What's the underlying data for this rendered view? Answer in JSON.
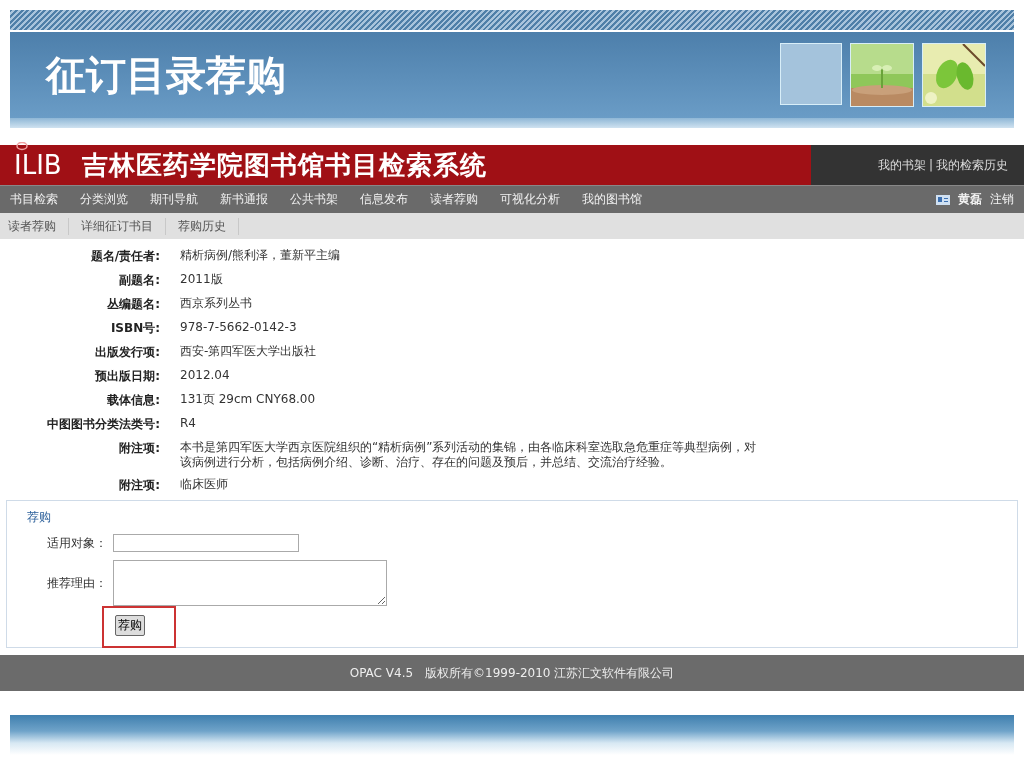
{
  "slide": {
    "title": "征订目录荐购",
    "thumbnails": [
      {
        "kind": "blank"
      },
      {
        "kind": "picture"
      },
      {
        "kind": "picture"
      }
    ]
  },
  "site": {
    "logo": "ILIB",
    "name": "吉林医药学院图书馆书目检索系统",
    "top_links": [
      "我的书架",
      "我的检索历史"
    ],
    "link_separator": "|"
  },
  "nav": {
    "items": [
      "书目检索",
      "分类浏览",
      "期刊导航",
      "新书通报",
      "公共书架",
      "信息发布",
      "读者荐购",
      "可视化分析",
      "我的图书馆"
    ],
    "user": "黄磊",
    "logout": "注销"
  },
  "subnav": [
    "读者荐购",
    "详细征订书目",
    "荐购历史"
  ],
  "record": [
    {
      "label": "题名/责任者:",
      "value": "精析病例/熊利泽，董新平主编"
    },
    {
      "label": "副题名:",
      "value": "2011版"
    },
    {
      "label": "丛编题名:",
      "value": "西京系列丛书"
    },
    {
      "label": "ISBN号:",
      "value": "978-7-5662-0142-3"
    },
    {
      "label": "出版发行项:",
      "value": "西安-第四军医大学出版社"
    },
    {
      "label": "预出版日期:",
      "value": "2012.04"
    },
    {
      "label": "载体信息:",
      "value": "131页 29cm CNY68.00"
    },
    {
      "label": "中图图书分类法类号:",
      "value": "R4"
    },
    {
      "label": "附注项:",
      "value": "本书是第四军医大学西京医院组织的“精析病例”系列活动的集锦，由各临床科室选取急危重症等典型病例，对该病例进行分析，包括病例介绍、诊断、治疗、存在的问题及预后，并总结、交流治疗经验。"
    },
    {
      "label": "附注项:",
      "value": "临床医师"
    }
  ],
  "form": {
    "legend": "荐购",
    "fields": [
      {
        "label": "适用对象：",
        "kind": "input"
      },
      {
        "label": "推荐理由：",
        "kind": "textarea"
      }
    ],
    "submit": "荐购",
    "submit_highlighted": true
  },
  "footer": "OPAC V4.5　版权所有©1999-2010 江苏汇文软件有限公司"
}
